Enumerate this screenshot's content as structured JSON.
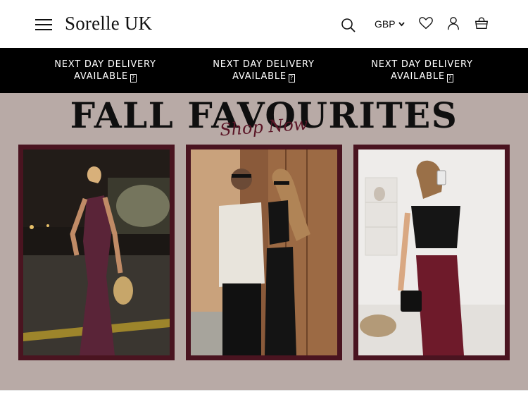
{
  "header": {
    "brand": "Sorelle UK",
    "currency": "GBP",
    "icons": [
      "menu-icon",
      "search-icon",
      "chevron-down-icon",
      "heart-icon",
      "user-icon",
      "bag-icon"
    ]
  },
  "announcement": {
    "items": [
      {
        "line1": "NEXT DAY DELIVERY",
        "line2": "AVAILABLE"
      },
      {
        "line1": "NEXT DAY DELIVERY",
        "line2": "AVAILABLE"
      },
      {
        "line1": "NEXT DAY DELIVERY",
        "line2": "AVAILABLE"
      }
    ],
    "glyph": "?"
  },
  "hero": {
    "title": "FALL FAVOURITES",
    "script": "Shop Now",
    "colors": {
      "background": "#b8aaa6",
      "frame": "#4a1420",
      "script": "#5a1526"
    }
  }
}
